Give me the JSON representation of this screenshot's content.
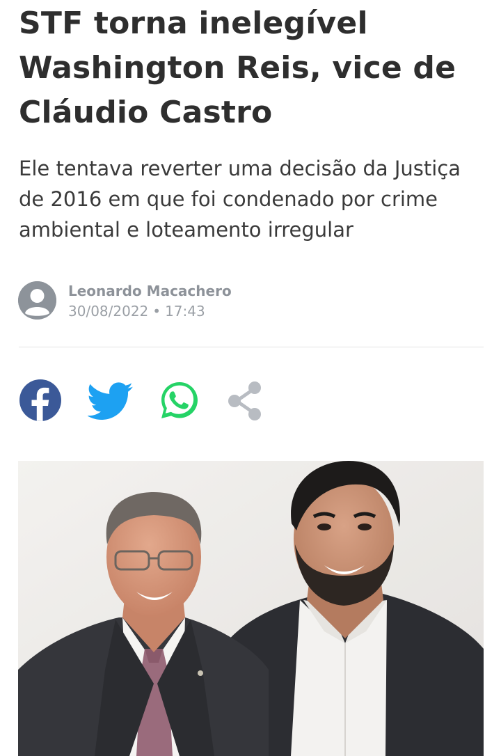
{
  "article": {
    "headline": "STF torna inelegível Washington Reis, vice de Cláudio Castro",
    "subtitle": "Ele tentava reverter uma decisão da Justiça de 2016 em que foi condenado por crime ambiental e loteamento irregular",
    "author": "Leonardo Macachero",
    "date": "30/08/2022",
    "separator": "•",
    "time": "17:43"
  },
  "share": [
    {
      "name": "facebook",
      "icon": "facebook-icon",
      "color": "#3b5998"
    },
    {
      "name": "twitter",
      "icon": "twitter-icon",
      "color": "#1da1f2"
    },
    {
      "name": "whatsapp",
      "icon": "whatsapp-icon",
      "color": "#25d366"
    },
    {
      "name": "share",
      "icon": "share-icon",
      "color": "#b8bcc2"
    }
  ],
  "photo": {
    "icon": "article-photo"
  }
}
